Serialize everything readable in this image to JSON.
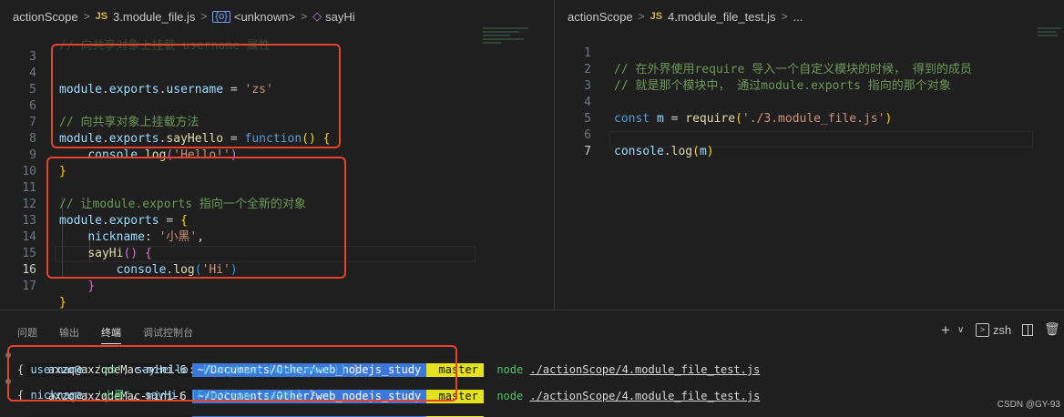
{
  "left_editor": {
    "breadcrumb": {
      "folder": "actionScope",
      "file_badge": "JS",
      "file": "3.module_file.js",
      "symbol_badge": "{o}",
      "symbol": "<unknown>",
      "method_badge": "◇",
      "method": "sayHi"
    },
    "top_partial": "// 向共享对象上挂载 username 属性",
    "lines": [
      {
        "n": "3",
        "text": ""
      },
      {
        "n": "4",
        "text": "module.exports.username = 'zs'"
      },
      {
        "n": "5",
        "text": ""
      },
      {
        "n": "6",
        "text": "// 向共享对象上挂载方法"
      },
      {
        "n": "7",
        "text": "module.exports.sayHello = function() {"
      },
      {
        "n": "8",
        "text": "    console.log('Hello!')"
      },
      {
        "n": "9",
        "text": "}"
      },
      {
        "n": "10",
        "text": ""
      },
      {
        "n": "11",
        "text": "// 让module.exports 指向一个全新的对象"
      },
      {
        "n": "12",
        "text": "module.exports = {"
      },
      {
        "n": "13",
        "text": "    nickname: '小黑',"
      },
      {
        "n": "14",
        "text": "    sayHi() {"
      },
      {
        "n": "15",
        "text": "        console.log('Hi')"
      },
      {
        "n": "16",
        "text": "    }"
      },
      {
        "n": "17",
        "text": "}"
      }
    ],
    "active_line": "16"
  },
  "right_editor": {
    "breadcrumb": {
      "folder": "actionScope",
      "file_badge": "JS",
      "file": "4.module_file_test.js",
      "more": "..."
    },
    "lines": [
      {
        "n": "1",
        "text": "// 在外界使用require 导入一个自定义模块的时候， 得到的成员"
      },
      {
        "n": "2",
        "text": "// 就是那个模块中， 通过module.exports 指向的那个对象"
      },
      {
        "n": "3",
        "text": ""
      },
      {
        "n": "4",
        "text": "const m = require('./3.module_file.js')"
      },
      {
        "n": "5",
        "text": ""
      },
      {
        "n": "6",
        "text": "console.log(m)"
      },
      {
        "n": "7",
        "text": ""
      }
    ],
    "active_line": "7"
  },
  "panel": {
    "tabs": [
      "问题",
      "输出",
      "终端",
      "调试控制台"
    ],
    "active_tab": "终端",
    "shell": "zsh",
    "add": "+",
    "chevron": "∨"
  },
  "terminal": {
    "user": "axzq@axzqdeMac-mini-6",
    "path": "~/Documents/Other/web_nodejs_study",
    "git_icon": "",
    "branch": "master",
    "cmd_name": "node",
    "cmd_arg": "./actionScope/4.module_file_test.js",
    "output1": {
      "open": "{ ",
      "k1": "username",
      "sep1": ": ",
      "v1": "'zs'",
      "sep2": ", ",
      "k2": "sayHello",
      "sep3": ": ",
      "v2": "[Function (anonymous)]",
      "close": " }"
    },
    "output2": {
      "open": "{ ",
      "k1": "nickname",
      "sep1": ": ",
      "v1": "'小黑'",
      "sep2": ", ",
      "k2": "sayHi",
      "sep3": ": ",
      "v2": "[Function: sayHi]",
      "close": " }"
    }
  },
  "watermark": "CSDN @GY-93",
  "colors": {
    "background": "#1f1f1f",
    "highlight_box": "#e8412c",
    "path_segment": "#3b78d8",
    "git_segment": "#e4e21c"
  }
}
